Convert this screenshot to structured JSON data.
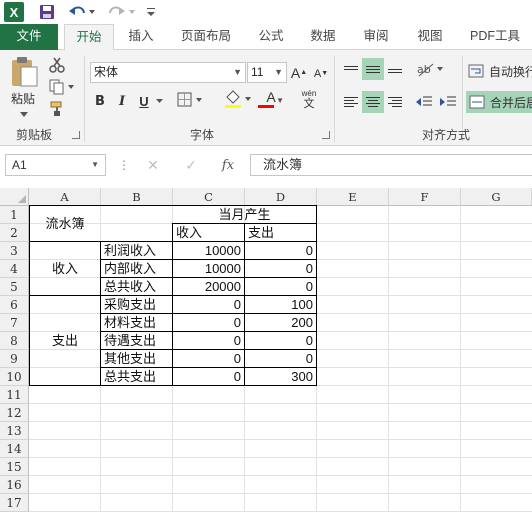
{
  "app": {
    "logo_letter": "X",
    "accent": "#217346",
    "ribbon_bg": "#f3f3f3",
    "selected_align_color": "#a6d4b8"
  },
  "quick_access": {
    "icons": [
      "excel-logo",
      "save-icon",
      "undo-icon",
      "redo-icon",
      "customize-icon"
    ]
  },
  "tabs": [
    "文件",
    "开始",
    "插入",
    "页面布局",
    "公式",
    "数据",
    "审阅",
    "视图",
    "PDF工具"
  ],
  "active_tab": "开始",
  "ribbon": {
    "clipboard": {
      "paste_label": "粘贴",
      "group_label": "剪贴板"
    },
    "font": {
      "font_name": "宋体",
      "font_size": "11",
      "grow_label": "A",
      "shrink_label": "A",
      "bold": "B",
      "italic": "I",
      "underline": "U",
      "font_color_letter": "A",
      "phonetic_top": "wén",
      "phonetic_bottom": "文",
      "group_label": "字体",
      "highlight_color": "#ffff00",
      "font_color": "#ff0000"
    },
    "alignment": {
      "wrap_text": "自动换行",
      "merge_center": "合并后居",
      "group_label": "对齐方式"
    }
  },
  "formula_bar": {
    "name_box": "A1",
    "fx_label": "fx",
    "cancel_symbol": "✕",
    "enter_symbol": "✓",
    "formula_value": "流水簿"
  },
  "grid": {
    "columns": [
      "A",
      "B",
      "C",
      "D",
      "E",
      "F",
      "G"
    ],
    "rows": [
      "1",
      "2",
      "3",
      "4",
      "5",
      "6",
      "7",
      "8",
      "9",
      "10",
      "11",
      "12",
      "13",
      "14",
      "15",
      "16",
      "17"
    ]
  },
  "sheet": {
    "a1_merged": "流水簿",
    "c1_merged": "当月产生",
    "c2": "收入",
    "d2": "支出",
    "income_group": "收入",
    "expense_group": "支出",
    "line_items": [
      {
        "label": "利润收入",
        "income": "10000",
        "expense": "0"
      },
      {
        "label": "内部收入",
        "income": "10000",
        "expense": "0"
      },
      {
        "label": "总共收入",
        "income": "20000",
        "expense": "0"
      },
      {
        "label": "采购支出",
        "income": "0",
        "expense": "100"
      },
      {
        "label": "材料支出",
        "income": "0",
        "expense": "200"
      },
      {
        "label": "待遇支出",
        "income": "0",
        "expense": "0"
      },
      {
        "label": "其他支出",
        "income": "0",
        "expense": "0"
      },
      {
        "label": "总共支出",
        "income": "0",
        "expense": "300"
      }
    ]
  }
}
